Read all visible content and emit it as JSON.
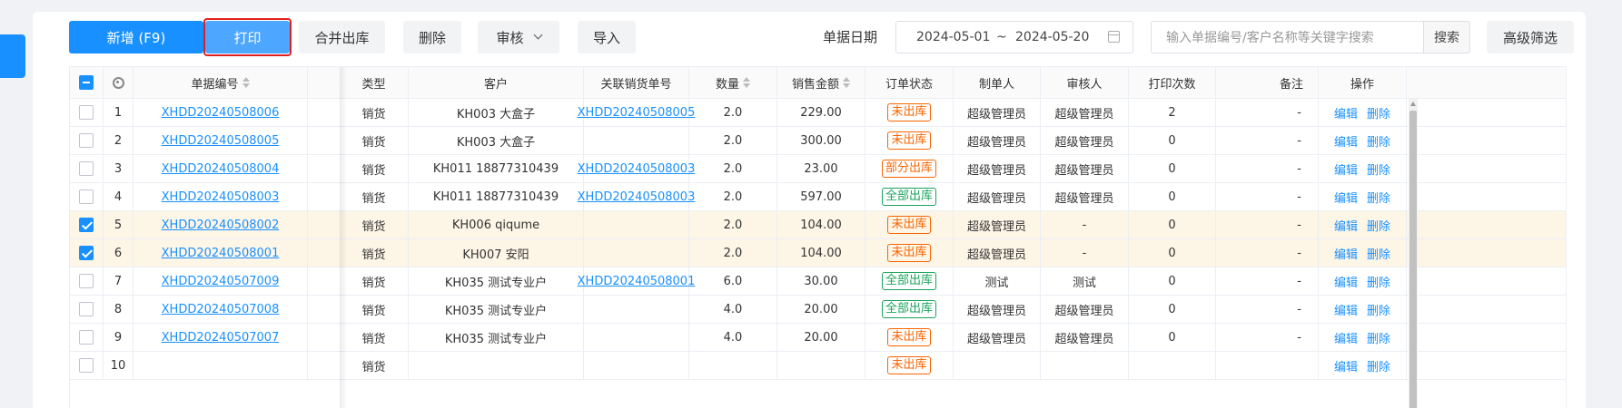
{
  "toolbar": {
    "new_label": "新增 (F9)",
    "print_label": "打印",
    "merge_label": "合并出库",
    "delete_label": "删除",
    "audit_label": "审核",
    "import_label": "导入",
    "date_label": "单据日期",
    "date_start": "2024-05-01",
    "date_sep": "~",
    "date_end": "2024-05-20",
    "search_placeholder": "输入单据编号/客户名称等关键字搜索",
    "search_label": "搜索",
    "advanced_label": "高级筛选"
  },
  "table": {
    "headers": {
      "no": "单据编号",
      "type": "类型",
      "customer": "客户",
      "linked": "关联销货单号",
      "qty": "数量",
      "amount": "销售金额",
      "status": "订单状态",
      "maker": "制单人",
      "auditor": "审核人",
      "prints": "打印次数",
      "remark": "备注",
      "ops": "操作"
    },
    "rows": [
      {
        "idx": "1",
        "no": "XHDD20240508006",
        "type": "销货",
        "customer": "KH003 大盒子",
        "linked": "XHDD20240508005",
        "qty": "2.0",
        "amount": "229.00",
        "status": "未出库",
        "status_color": "orange",
        "maker": "超级管理员",
        "auditor": "超级管理员",
        "prints": "2",
        "remark": "-",
        "edit": "编辑",
        "del": "删除",
        "checked": false
      },
      {
        "idx": "2",
        "no": "XHDD20240508005",
        "type": "销货",
        "customer": "KH003 大盒子",
        "linked": "",
        "qty": "2.0",
        "amount": "300.00",
        "status": "未出库",
        "status_color": "orange",
        "maker": "超级管理员",
        "auditor": "超级管理员",
        "prints": "0",
        "remark": "-",
        "edit": "编辑",
        "del": "删除",
        "checked": false
      },
      {
        "idx": "3",
        "no": "XHDD20240508004",
        "type": "销货",
        "customer": "KH011 18877310439",
        "linked": "XHDD20240508003",
        "qty": "2.0",
        "amount": "23.00",
        "status": "部分出库",
        "status_color": "orange",
        "maker": "超级管理员",
        "auditor": "超级管理员",
        "prints": "0",
        "remark": "-",
        "edit": "编辑",
        "del": "删除",
        "checked": false
      },
      {
        "idx": "4",
        "no": "XHDD20240508003",
        "type": "销货",
        "customer": "KH011 18877310439",
        "linked": "XHDD20240508003",
        "qty": "2.0",
        "amount": "597.00",
        "status": "全部出库",
        "status_color": "green",
        "maker": "超级管理员",
        "auditor": "超级管理员",
        "prints": "0",
        "remark": "-",
        "edit": "编辑",
        "del": "删除",
        "checked": false
      },
      {
        "idx": "5",
        "no": "XHDD20240508002",
        "type": "销货",
        "customer": "KH006 qiqume",
        "linked": "",
        "qty": "2.0",
        "amount": "104.00",
        "status": "未出库",
        "status_color": "orange",
        "maker": "超级管理员",
        "auditor": "-",
        "prints": "0",
        "remark": "-",
        "edit": "编辑",
        "del": "删除",
        "checked": true
      },
      {
        "idx": "6",
        "no": "XHDD20240508001",
        "type": "销货",
        "customer": "KH007 安阳",
        "linked": "",
        "qty": "2.0",
        "amount": "104.00",
        "status": "未出库",
        "status_color": "orange",
        "maker": "超级管理员",
        "auditor": "-",
        "prints": "0",
        "remark": "-",
        "edit": "编辑",
        "del": "删除",
        "checked": true
      },
      {
        "idx": "7",
        "no": "XHDD20240507009",
        "type": "销货",
        "customer": "KH035 测试专业户",
        "linked": "XHDD20240508001",
        "qty": "6.0",
        "amount": "30.00",
        "status": "全部出库",
        "status_color": "green",
        "maker": "测试",
        "auditor": "测试",
        "prints": "0",
        "remark": "-",
        "edit": "编辑",
        "del": "删除",
        "checked": false
      },
      {
        "idx": "8",
        "no": "XHDD20240507008",
        "type": "销货",
        "customer": "KH035 测试专业户",
        "linked": "",
        "qty": "4.0",
        "amount": "20.00",
        "status": "全部出库",
        "status_color": "green",
        "maker": "超级管理员",
        "auditor": "超级管理员",
        "prints": "0",
        "remark": "-",
        "edit": "编辑",
        "del": "删除",
        "checked": false
      },
      {
        "idx": "9",
        "no": "XHDD20240507007",
        "type": "销货",
        "customer": "KH035 测试专业户",
        "linked": "",
        "qty": "4.0",
        "amount": "20.00",
        "status": "未出库",
        "status_color": "orange",
        "maker": "超级管理员",
        "auditor": "超级管理员",
        "prints": "0",
        "remark": "-",
        "edit": "编辑",
        "del": "删除",
        "checked": false
      },
      {
        "idx": "10",
        "no": "",
        "type": "销货",
        "customer": "",
        "linked": "",
        "qty": "",
        "amount": "",
        "status": "未出库",
        "status_color": "orange",
        "maker": "",
        "auditor": "",
        "prints": "",
        "remark": "",
        "edit": "编辑",
        "del": "删除",
        "checked": false
      }
    ]
  },
  "colors": {
    "primary": "#1890ff",
    "highlight_red": "#e02020",
    "status_orange": "#fa6400",
    "status_green": "#19a35a",
    "selected_row": "#fdf5e6"
  }
}
